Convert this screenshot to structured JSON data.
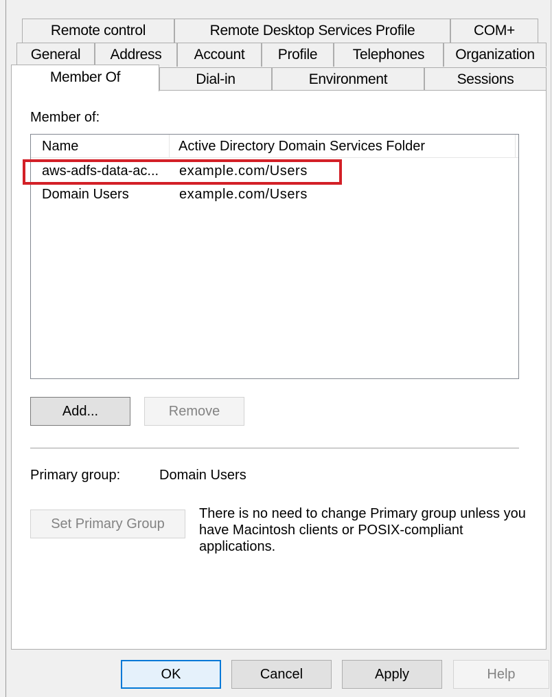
{
  "tabs": {
    "row1": [
      "Remote control",
      "Remote Desktop Services Profile",
      "COM+"
    ],
    "row2": [
      "General",
      "Address",
      "Account",
      "Profile",
      "Telephones",
      "Organization"
    ],
    "row3": [
      "Member Of",
      "Dial-in",
      "Environment",
      "Sessions"
    ]
  },
  "member_of": {
    "label": "Member of:",
    "columns": [
      "Name",
      "Active Directory Domain Services Folder"
    ],
    "rows": [
      {
        "name": "aws-adfs-data-ac...",
        "folder": "example.com/Users"
      },
      {
        "name": "Domain Users",
        "folder": "example.com/Users"
      }
    ],
    "add_label": "Add...",
    "remove_label": "Remove"
  },
  "primary_group": {
    "label": "Primary group:",
    "value": "Domain Users",
    "set_button_label": "Set Primary Group",
    "note": "There is no need to change Primary group unless you have Macintosh clients or POSIX-compliant applications."
  },
  "dialog_buttons": {
    "ok": "OK",
    "cancel": "Cancel",
    "apply": "Apply",
    "help": "Help"
  },
  "colors": {
    "highlight": "#d32027",
    "default_button_border": "#0078d7"
  }
}
